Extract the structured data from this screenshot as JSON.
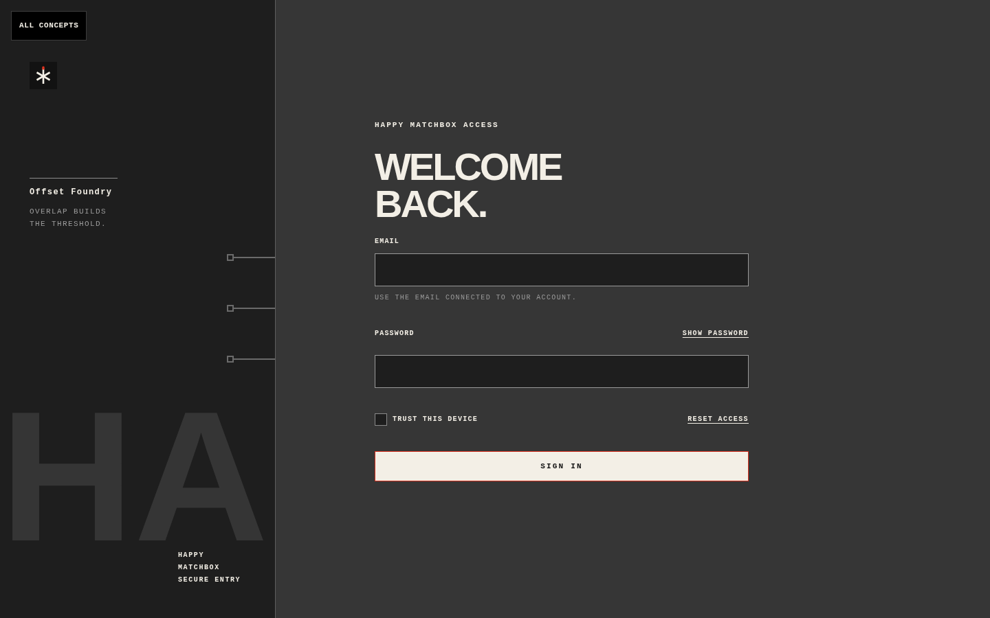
{
  "sidebar": {
    "back_button": "ALL CONCEPTS",
    "project": {
      "name": "Offset Foundry",
      "tagline": "OVERLAP BUILDS THE THRESHOLD."
    },
    "backdrop_letters": "HA",
    "caption": "HAPPY MATCHBOX SECURE ENTRY"
  },
  "form": {
    "eyebrow": "HAPPY MATCHBOX ACCESS",
    "heading": "WELCOME BACK.",
    "email": {
      "label": "EMAIL",
      "hint": "USE THE EMAIL CONNECTED TO YOUR ACCOUNT."
    },
    "password": {
      "label": "PASSWORD",
      "toggle": "SHOW PASSWORD"
    },
    "trust_device": {
      "label": "TRUST THIS DEVICE",
      "checked": false
    },
    "reset_link": "RESET ACCESS",
    "submit": "SIGN IN"
  }
}
